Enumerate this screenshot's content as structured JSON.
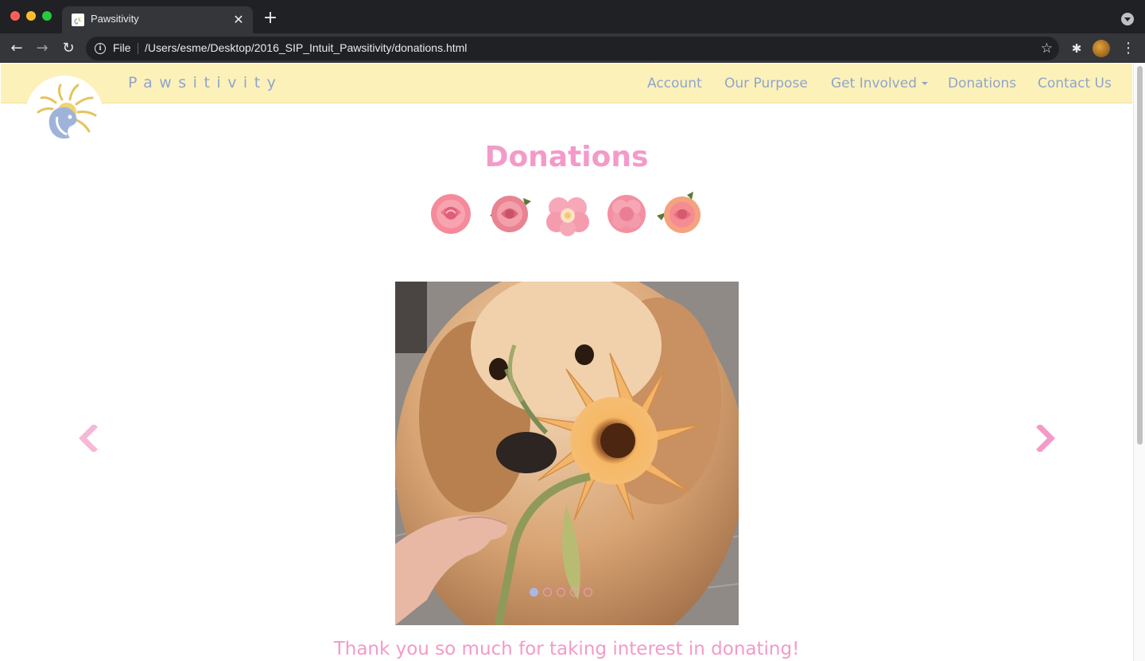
{
  "browser": {
    "tab_title": "Pawsitivity",
    "tab_close": "✕",
    "new_tab": "+",
    "back": "←",
    "forward": "→",
    "reload": "↻",
    "scheme_label": "File",
    "url": "/Users/esme/Desktop/2016_SIP_Intuit_Pawsitivity/donations.html",
    "star": "☆",
    "extensions": "✱",
    "menu": "⋮",
    "icons": [
      "info-icon",
      "star-icon",
      "puzzle-icon",
      "profile-avatar",
      "kebab-menu-icon"
    ]
  },
  "navbar": {
    "brand": "Pawsitivity",
    "links": [
      {
        "label": "Account"
      },
      {
        "label": "Our Purpose"
      },
      {
        "label": "Get Involved",
        "dropdown": true
      },
      {
        "label": "Donations"
      },
      {
        "label": "Contact Us"
      }
    ]
  },
  "main": {
    "title": "Donations",
    "flowers": [
      "rose",
      "rose",
      "hibiscus",
      "carnation",
      "rose"
    ],
    "carousel": {
      "slide_count": 5,
      "active_index": 0,
      "prev_label": "‹",
      "next_label": "›"
    },
    "thanks": "Thank you so much for taking interest in donating!"
  },
  "colors": {
    "navbar_bg": "#fdf1ba",
    "nav_text": "#8ea5cc",
    "accent_pink": "#f49ac8",
    "indicator_active": "#a9b7e8"
  }
}
